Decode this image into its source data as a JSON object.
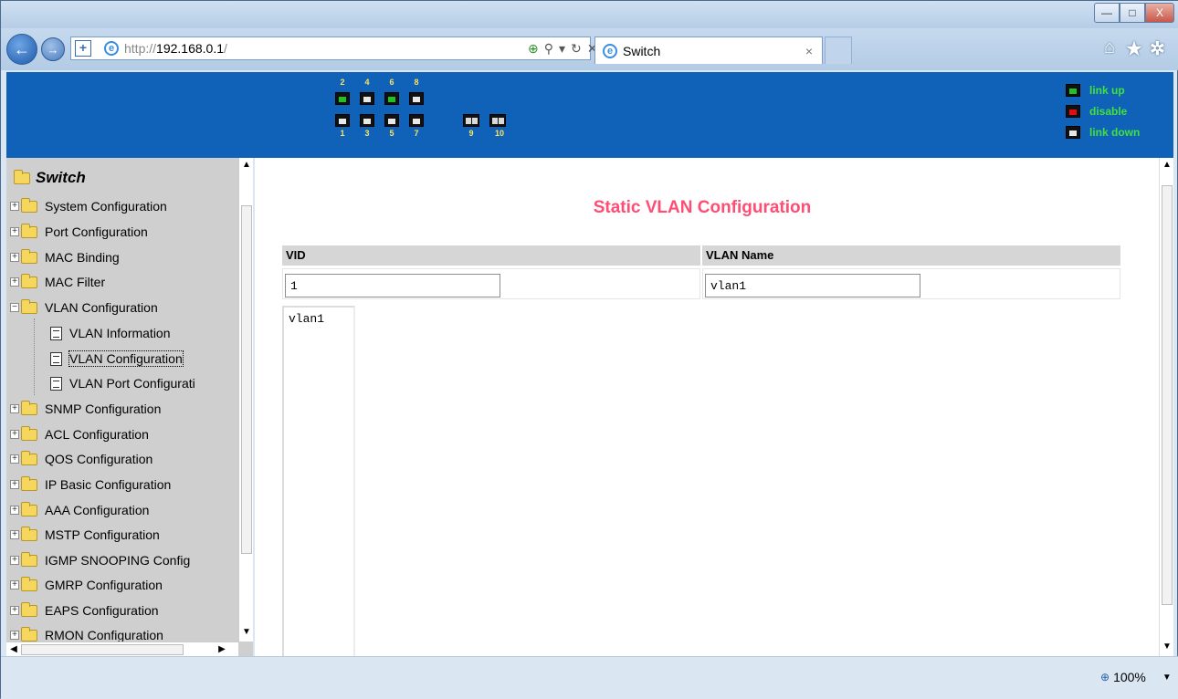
{
  "browser": {
    "url_protocol": "http://",
    "url_host": "192.168.0.1",
    "url_slash": "/",
    "tab_title": "Switch",
    "tab_close": "×",
    "zoom": "100%",
    "window_buttons": {
      "minimize": "—",
      "maximize": "□",
      "close": "X"
    },
    "icons": [
      "back-icon",
      "forward-icon",
      "home-icon",
      "star-icon",
      "gear-icon"
    ]
  },
  "banner": {
    "ports_top": [
      {
        "num": "2",
        "status": "link up"
      },
      {
        "num": "4",
        "status": "link down"
      },
      {
        "num": "6",
        "status": "link up"
      },
      {
        "num": "8",
        "status": "link down"
      }
    ],
    "ports_bottom": [
      {
        "num": "1",
        "status": "link down"
      },
      {
        "num": "3",
        "status": "link down"
      },
      {
        "num": "5",
        "status": "link down"
      },
      {
        "num": "7",
        "status": "link down"
      }
    ],
    "fiber_ports": [
      "9",
      "10"
    ],
    "legend": [
      {
        "label": "link up",
        "color": "#22c022"
      },
      {
        "label": "disable",
        "color": "#e01010"
      },
      {
        "label": "link down",
        "color": "#e8e8e8"
      }
    ]
  },
  "sidebar": {
    "root": "Switch",
    "items": [
      {
        "label": "System Configuration"
      },
      {
        "label": "Port Configuration"
      },
      {
        "label": "MAC Binding"
      },
      {
        "label": "MAC Filter"
      },
      {
        "label": "VLAN Configuration",
        "expanded": true
      },
      {
        "label": "SNMP Configuration"
      },
      {
        "label": "ACL Configuration"
      },
      {
        "label": "QOS Configuration"
      },
      {
        "label": "IP Basic Configuration"
      },
      {
        "label": "AAA Configuration"
      },
      {
        "label": "MSTP Configuration"
      },
      {
        "label": "IGMP SNOOPING Config"
      },
      {
        "label": "GMRP Configuration"
      },
      {
        "label": "EAPS Configuration"
      },
      {
        "label": "RMON Configuration"
      }
    ],
    "vlan_children": [
      {
        "label": "VLAN Information"
      },
      {
        "label": "VLAN Configuration",
        "selected": true
      },
      {
        "label": "VLAN Port Configurati"
      }
    ]
  },
  "main": {
    "title": "Static VLAN Configuration",
    "vid_header": "VID",
    "name_header": "VLAN Name",
    "vid_value": "1",
    "name_value": "vlan1",
    "vlan_list": [
      "vlan1"
    ]
  }
}
